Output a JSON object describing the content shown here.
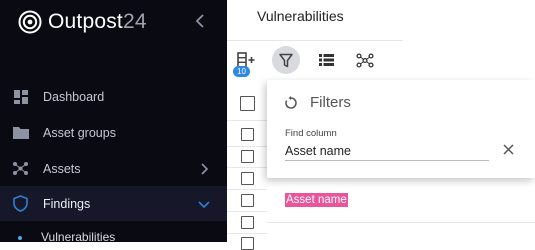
{
  "brand": {
    "name": "Outpost",
    "suffix": "24"
  },
  "sidebar": {
    "items": [
      {
        "label": "Dashboard",
        "icon": "dashboard-icon"
      },
      {
        "label": "Asset groups",
        "icon": "folder-icon"
      },
      {
        "label": "Assets",
        "icon": "network-icon"
      },
      {
        "label": "Findings",
        "icon": "shield-icon"
      }
    ],
    "sub_item": "Vulnerabilities"
  },
  "main": {
    "title": "Vulnerabilities",
    "column_badge": "10"
  },
  "filters": {
    "title": "Filters",
    "field_label": "Find column",
    "field_value": "Asset name",
    "result": "Asset name"
  },
  "colors": {
    "sidebar_bg": "#0a0b12",
    "highlight": "#e8559a",
    "badge": "#2f88e8",
    "active_icon": "#2f7fd8"
  }
}
